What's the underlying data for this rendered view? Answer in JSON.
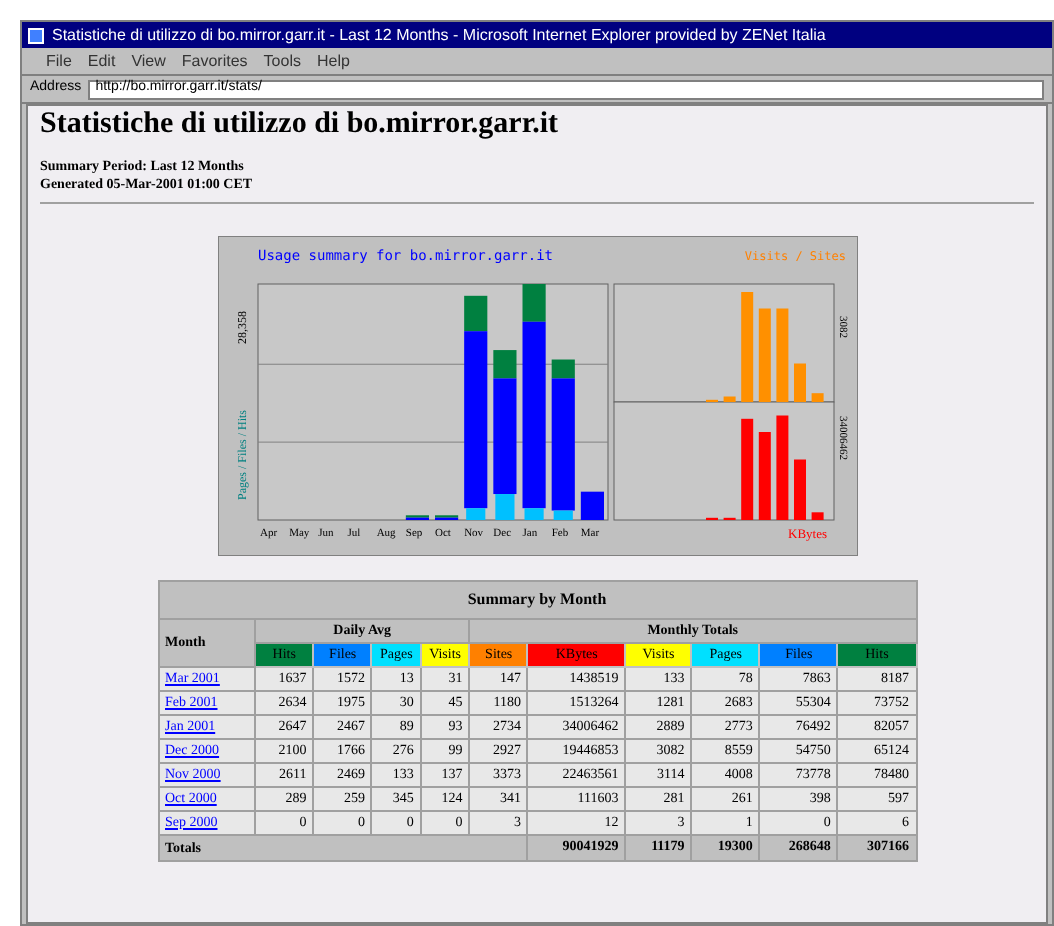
{
  "window": {
    "title": "Statistiche di utilizzo di bo.mirror.garr.it - Last 12 Months - Microsoft Internet Explorer provided by ZENet Italia"
  },
  "menu": [
    "File",
    "Edit",
    "View",
    "Favorites",
    "Tools",
    "Help"
  ],
  "address": {
    "label": "Address",
    "value": "http://bo.mirror.garr.it/stats/"
  },
  "page": {
    "heading": "Statistiche di utilizzo di bo.mirror.garr.it",
    "period": "Summary Period: Last 12 Months",
    "generated": "Generated 05-Mar-2001 01:00 CET"
  },
  "chart": {
    "title": "Usage summary for bo.mirror.garr.it",
    "top_tick": "28,358",
    "left_label": "Pages / Files / Hits",
    "legend_right": "Visits / Sites",
    "right_top_label": "3082",
    "right_bottom_label": "34006462",
    "kbytes_label": "KBytes",
    "months": [
      "Apr",
      "May",
      "Jun",
      "Jul",
      "Aug",
      "Sep",
      "Oct",
      "Nov",
      "Dec",
      "Jan",
      "Feb",
      "Mar"
    ]
  },
  "table": {
    "title": "Summary by Month",
    "month_header": "Month",
    "daily_header": "Daily Avg",
    "monthly_header": "Monthly Totals",
    "columns": [
      {
        "label": "Hits",
        "color": "#008040"
      },
      {
        "label": "Files",
        "color": "#0080ff"
      },
      {
        "label": "Pages",
        "color": "#00e0ff"
      },
      {
        "label": "Visits",
        "color": "#ffff00"
      },
      {
        "label": "Sites",
        "color": "#ff8000"
      },
      {
        "label": "KBytes",
        "color": "#ff0000"
      },
      {
        "label": "Visits",
        "color": "#ffff00"
      },
      {
        "label": "Pages",
        "color": "#00e0ff"
      },
      {
        "label": "Files",
        "color": "#0080ff"
      },
      {
        "label": "Hits",
        "color": "#008040"
      }
    ],
    "rows": [
      {
        "month": "Mar 2001",
        "cells": [
          "1637",
          "1572",
          "13",
          "31",
          "147",
          "1438519",
          "133",
          "78",
          "7863",
          "8187"
        ]
      },
      {
        "month": "Feb 2001",
        "cells": [
          "2634",
          "1975",
          "30",
          "45",
          "1180",
          "1513264",
          "1281",
          "2683",
          "55304",
          "73752"
        ]
      },
      {
        "month": "Jan 2001",
        "cells": [
          "2647",
          "2467",
          "89",
          "93",
          "2734",
          "34006462",
          "2889",
          "2773",
          "76492",
          "82057"
        ]
      },
      {
        "month": "Dec 2000",
        "cells": [
          "2100",
          "1766",
          "276",
          "99",
          "2927",
          "19446853",
          "3082",
          "8559",
          "54750",
          "65124"
        ]
      },
      {
        "month": "Nov 2000",
        "cells": [
          "2611",
          "2469",
          "133",
          "137",
          "3373",
          "22463561",
          "3114",
          "4008",
          "73778",
          "78480"
        ]
      },
      {
        "month": "Oct 2000",
        "cells": [
          "289",
          "259",
          "345",
          "124",
          "341",
          "111603",
          "281",
          "261",
          "398",
          "597"
        ]
      },
      {
        "month": "Sep 2000",
        "cells": [
          "0",
          "0",
          "0",
          "0",
          "3",
          "12",
          "3",
          "1",
          "0",
          "6"
        ]
      }
    ],
    "totals_label": "Totals",
    "totals": [
      "90041929",
      "11179",
      "19300",
      "268648",
      "307166"
    ]
  }
}
